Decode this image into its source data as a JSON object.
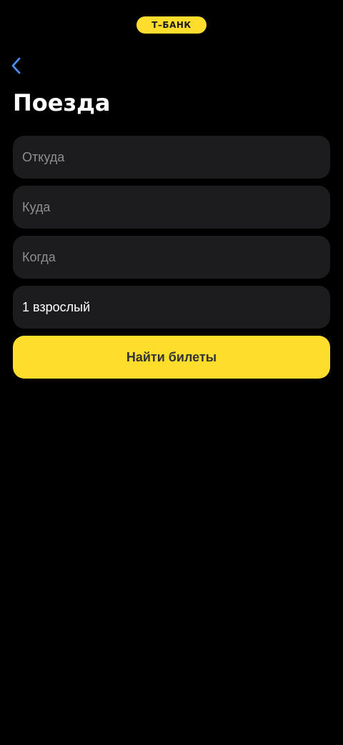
{
  "header": {
    "brand_label": "Т–БАНК",
    "back_icon": "chevron-left-icon"
  },
  "page": {
    "title": "Поезда"
  },
  "form": {
    "from": {
      "placeholder": "Откуда",
      "value": ""
    },
    "to": {
      "placeholder": "Куда",
      "value": ""
    },
    "date": {
      "placeholder": "Когда",
      "value": ""
    },
    "passengers": {
      "value": "1 взрослый"
    },
    "submit_label": "Найти билеты"
  },
  "colors": {
    "background": "#000000",
    "field_background": "#1c1c1e",
    "placeholder": "#8e8e93",
    "accent": "#ffdd2d",
    "back_icon": "#4a8ef8"
  }
}
